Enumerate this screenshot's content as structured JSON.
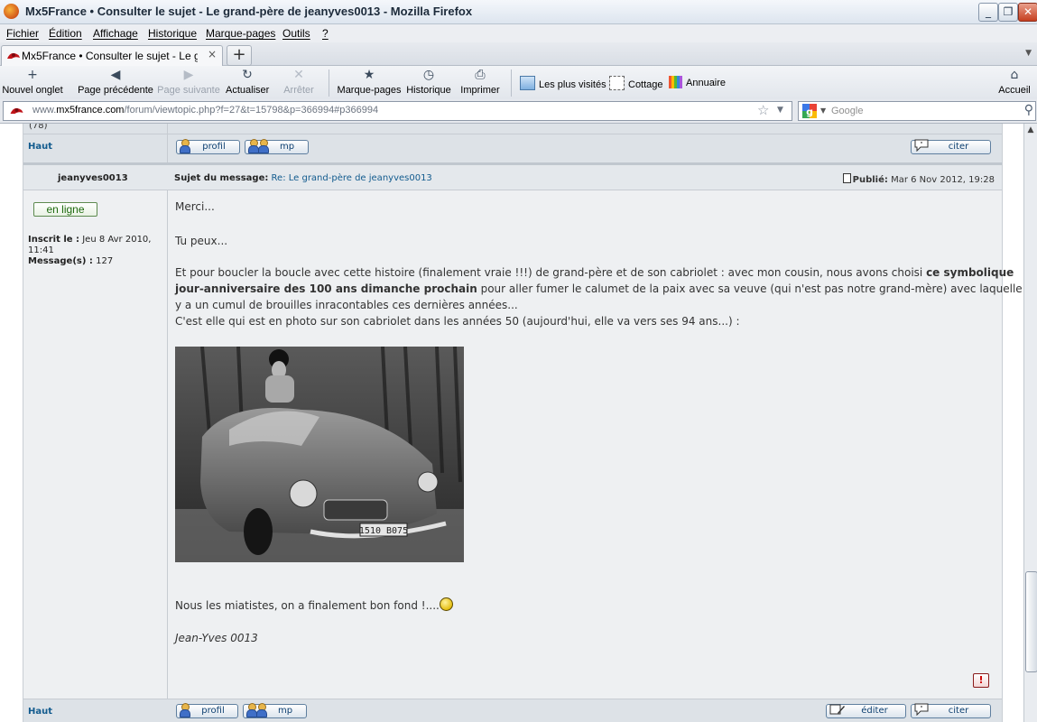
{
  "window": {
    "title": "Mx5France • Consulter le sujet - Le grand-père de jeanyves0013 - Mozilla Firefox",
    "controls": {
      "minimize": "_",
      "maximize": "❐",
      "close": "✕"
    }
  },
  "menu": [
    "Fichier",
    "Édition",
    "Affichage",
    "Historique",
    "Marque-pages",
    "Outils",
    "?"
  ],
  "tab": {
    "label": "Mx5France • Consulter le sujet - Le grand-p...",
    "close": "×",
    "new_tab": "+",
    "list": "▼"
  },
  "toolbar": {
    "new_tab": "Nouvel onglet",
    "back": "Page précédente",
    "forward": "Page suivante",
    "reload": "Actualiser",
    "stop": "Arrêter",
    "bookmarks": "Marque-pages",
    "history": "Historique",
    "print": "Imprimer",
    "home": "Accueil",
    "icons": {
      "new_tab": "+",
      "back": "◀",
      "forward": "▶",
      "reload": "↻",
      "stop": "✕",
      "bookmarks": "★",
      "history": "◷",
      "print": "⎙",
      "home": "⌂"
    }
  },
  "bookmarks_bar": [
    "Les plus visités",
    "Cottage",
    "Annuaire"
  ],
  "address": {
    "url_prefix": "www.",
    "url_domain": "mx5france.com",
    "url_rest": "/forum/viewtopic.php?f=27&t=15798&p=366994#p366994",
    "star": "☆",
    "dropdown": "▼",
    "search_placeholder": "Google",
    "search_dropdown": "▼",
    "search_icon": "⚲"
  },
  "forum": {
    "prev_post_count": "(78)",
    "haut": "Haut",
    "btn_profil": "profil",
    "btn_mp": "mp",
    "btn_citer": "citer",
    "btn_editer": "éditer",
    "post": {
      "author": "jeanyves0013",
      "subject_label": "Sujet du message:",
      "subject": "Re: Le grand-père de jeanyves0013",
      "published_label": "Publié:",
      "published_date": "Mar 6 Nov 2012, 19:28",
      "online_status": "en ligne",
      "joined_label": "Inscrit le :",
      "joined_line1": "Jeu 8 Avr 2010,",
      "joined_line2": "11:41",
      "messages_label": "Message(s) :",
      "messages_count": "127",
      "paragraphs": {
        "p1": "Merci...",
        "p2": "Tu peux...",
        "p3_line1_a": "Et pour boucler la boucle avec cette histoire (finalement vraie !!!) de grand-père et de son cabriolet : avec mon cousin, nous avons choisi ",
        "p3_line1_b": "ce symbolique",
        "p3_line2_a": "jour-anniversaire des 100 ans dimanche prochain",
        "p3_line2_b": " pour aller fumer le calumet de la paix avec sa veuve (qui n'est pas notre grand-mère) avec laquelle il",
        "p3_line3": "y a un cumul de brouilles inracontables ces dernières années...",
        "p3_line4": "C'est elle qui est en photo sur son cabriolet dans les années 50 (aujourd'hui, elle va vers ses 94 ans...) :",
        "p4": "Nous les miatistes, on a finalement bon fond !....",
        "signature": "Jean-Yves 0013"
      },
      "photo_plate": "1510 B075",
      "report_icon": "!"
    }
  }
}
